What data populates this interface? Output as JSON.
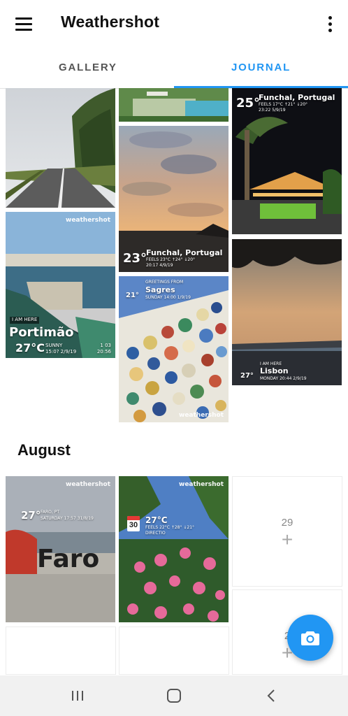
{
  "app": {
    "title": "Weathershot"
  },
  "tabs": [
    {
      "label": "GALLERY",
      "selected": false
    },
    {
      "label": "JOURNAL",
      "selected": true
    }
  ],
  "accent_color": "#2196f3",
  "photos": {
    "road": {
      "description_icon": "road-photo"
    },
    "pool": {
      "description_icon": "pool-photo"
    },
    "funchal_night": {
      "temp": "25°",
      "city": "Funchal, Portugal",
      "feels": "FEELS 17°C  ↑21° ↓20°",
      "time": "23:22 5/9/19"
    },
    "funchal_sunset": {
      "temp": "23°",
      "city": "Funchal, Portugal",
      "feels": "FEELS 23°C  ↑24° ↓20°",
      "time": "20:17 4/9/19"
    },
    "portimao": {
      "watermark": "weathershot",
      "tag": "I AM HERE",
      "city": "Portimão",
      "temp": "27°C",
      "cond": "SUNNY",
      "time": "15:0? 2/9/19",
      "extra1": "1 03",
      "extra2": "20:56"
    },
    "sagres": {
      "greeting": "GREETINGS FROM",
      "temp": "21°",
      "city": "Sagres",
      "time": "SUNDAY 14:00 1/9/19",
      "watermark": "weathershot"
    },
    "lisbon": {
      "tag": "I AM HERE",
      "temp": "27°",
      "city": "Lisbon",
      "time": "MONDAY 20:44 2/9/19"
    },
    "faro": {
      "watermark": "weathershot",
      "temp": "27°",
      "loc": "FARO, PT",
      "time": "SATURDAY 17:57 31/8/19",
      "sign": "Faro"
    },
    "flowers": {
      "watermark": "weathershot",
      "day": "30",
      "temp": "27°C",
      "feels": "FEELS 22°C  ↑28° ↓21°",
      "cond": "DIRECTIO"
    }
  },
  "sections": {
    "month": "August"
  },
  "empty_days": [
    {
      "num": "29",
      "plus": "+"
    },
    {
      "num": "2",
      "plus": "+"
    }
  ],
  "fab": {
    "icon": "camera-icon"
  },
  "nav": {
    "recent": "recent-apps-icon",
    "home": "home-icon",
    "back": "back-icon"
  }
}
